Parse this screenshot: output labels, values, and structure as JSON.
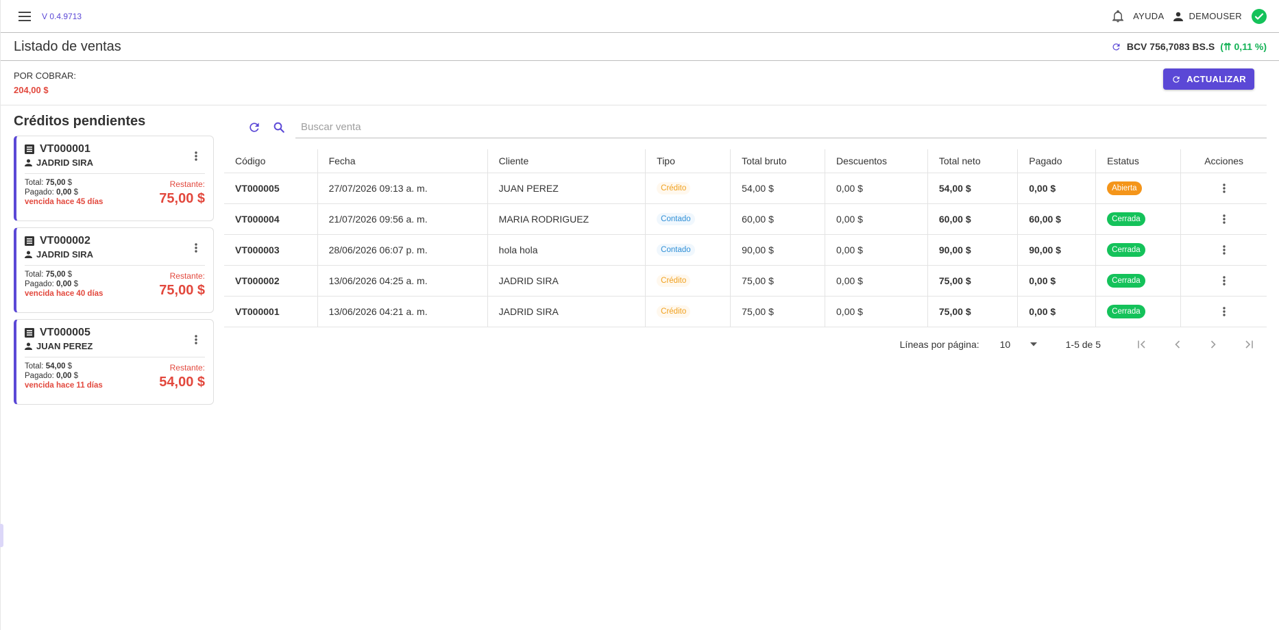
{
  "topbar": {
    "version": "V 0.4.9713",
    "help_label": "AYUDA",
    "user_name": "DEMOUSER"
  },
  "header": {
    "title": "Listado de ventas",
    "rate_label": "BCV 756,7083 BS.S",
    "rate_change": "(⇈ 0,11 %)"
  },
  "summary": {
    "label": "POR COBRAR:",
    "value": "204,00 $",
    "refresh_label": "ACTUALIZAR"
  },
  "credits": {
    "title": "Créditos pendientes",
    "total_prefix": "Total:",
    "paid_prefix": "Pagado:",
    "remaining_label": "Restante:",
    "items": [
      {
        "code": "VT000001",
        "client": "JADRID SIRA",
        "total": "75,00",
        "paid": "0,00",
        "overdue": "vencida hace 45 días",
        "remaining": "75,00 $"
      },
      {
        "code": "VT000002",
        "client": "JADRID SIRA",
        "total": "75,00",
        "paid": "0,00",
        "overdue": "vencida hace 40 días",
        "remaining": "75,00 $"
      },
      {
        "code": "VT000005",
        "client": "JUAN PEREZ",
        "total": "54,00",
        "paid": "0,00",
        "overdue": "vencida hace 11 días",
        "remaining": "54,00 $"
      }
    ]
  },
  "search": {
    "placeholder": "Buscar venta"
  },
  "table": {
    "columns": [
      "Código",
      "Fecha",
      "Cliente",
      "Tipo",
      "Total bruto",
      "Descuentos",
      "Total neto",
      "Pagado",
      "Estatus",
      "Acciones"
    ],
    "rows": [
      {
        "code": "VT000005",
        "date": "27/07/2026 09:13 a. m.",
        "client": "JUAN PEREZ",
        "type": "Crédito",
        "gross": "54,00 $",
        "discount": "0,00 $",
        "net": "54,00 $",
        "paid": "0,00 $",
        "status": "Abierta"
      },
      {
        "code": "VT000004",
        "date": "21/07/2026 09:56 a. m.",
        "client": "MARIA RODRIGUEZ",
        "type": "Contado",
        "gross": "60,00 $",
        "discount": "0,00 $",
        "net": "60,00 $",
        "paid": "60,00 $",
        "status": "Cerrada"
      },
      {
        "code": "VT000003",
        "date": "28/06/2026 06:07 p. m.",
        "client": "hola hola",
        "type": "Contado",
        "gross": "90,00 $",
        "discount": "0,00 $",
        "net": "90,00 $",
        "paid": "90,00 $",
        "status": "Cerrada"
      },
      {
        "code": "VT000002",
        "date": "13/06/2026 04:25 a. m.",
        "client": "JADRID SIRA",
        "type": "Crédito",
        "gross": "75,00 $",
        "discount": "0,00 $",
        "net": "75,00 $",
        "paid": "0,00 $",
        "status": "Cerrada"
      },
      {
        "code": "VT000001",
        "date": "13/06/2026 04:21 a. m.",
        "client": "JADRID SIRA",
        "type": "Crédito",
        "gross": "75,00 $",
        "discount": "0,00 $",
        "net": "75,00 $",
        "paid": "0,00 $",
        "status": "Cerrada"
      }
    ]
  },
  "pagination": {
    "rows_label": "Líneas por página:",
    "rows_value": "10",
    "range": "1-5 de 5"
  },
  "colors": {
    "primary": "#5b48d6",
    "danger": "#e2483d",
    "success": "#14c25a",
    "warning": "#f4951a",
    "info": "#2f8fd6"
  }
}
